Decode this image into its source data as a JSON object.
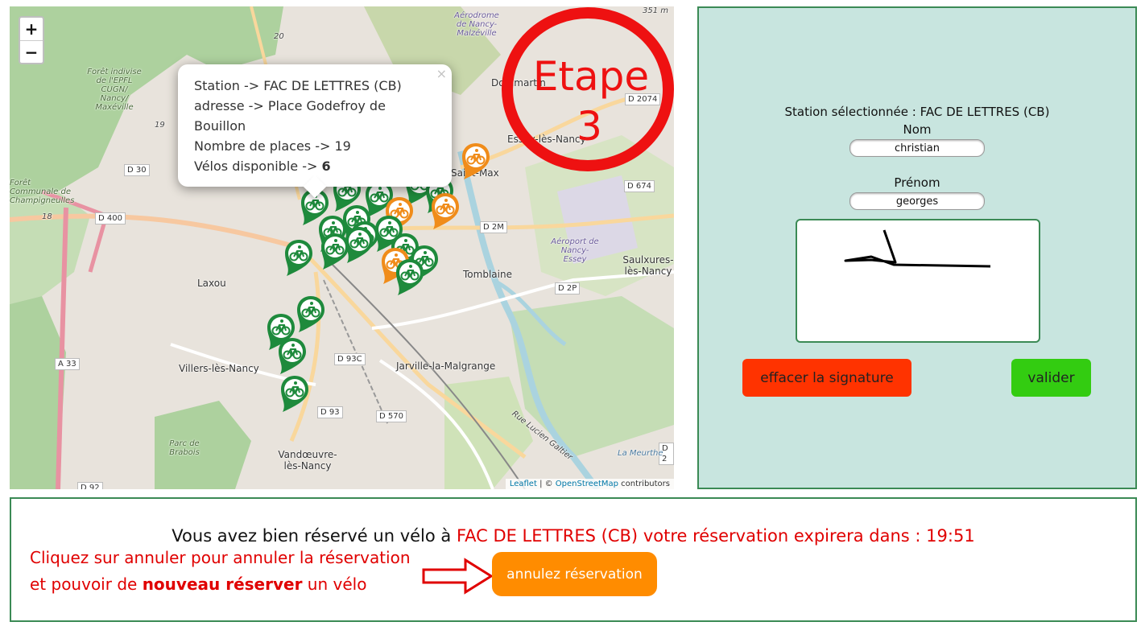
{
  "map": {
    "zoom_in": "+",
    "zoom_out": "−",
    "places": {
      "laxou": "Laxou",
      "villers": "Villers-lès-Nancy",
      "jarville": "Jarville-la-Malgrange",
      "vandoeuvre": "Vandœuvre-lès-Nancy",
      "tomblaine": "Tomblaine",
      "saulxures": "Saulxures-lès-Nancy",
      "essey": "Essey-lès-Nancy",
      "dommartin": "Dommartin",
      "saintmax": "Saint-Max",
      "aerodrome": "Aérodrome de Nancy-Malzéville",
      "aeroport": "Aéroport de Nancy-Essey",
      "foret": "Forêt indivise de l'EPFL CUGN/ Nancy/ Maxéville",
      "champigneulles": "Forêt Communale de Champigneulles",
      "brabois": "Parc de Brabois"
    },
    "roads": {
      "d30": "D 30",
      "d400": "D 400",
      "a33": "A 33",
      "d93c": "D 93C",
      "d93": "D 93",
      "d570": "D 570",
      "d92": "D 92",
      "d2m": "D 2M",
      "d2p": "D 2P",
      "d674": "D 674",
      "d2074": "D 2074",
      "d2": "D 2",
      "n20": "20",
      "n19": "19",
      "n18": "18",
      "alt": "351 m",
      "rue": "Rue Lucien Galtier",
      "meurthe": "La Meurthe"
    },
    "attribution": {
      "leaflet": "Leaflet",
      "sep": " | © ",
      "osm": "OpenStreetMap",
      "rest": " contributors"
    },
    "popup": {
      "station": "Station -> FAC DE LETTRES (CB)",
      "adresse_1": "adresse -> Place Godefroy de",
      "adresse_2": "Bouillon",
      "places": "Nombre de places -> 19",
      "velos_label": "Vélos disponible -> ",
      "velos_value": "6",
      "close": "×"
    },
    "etape": {
      "word": "Etape",
      "number": "3",
      "color": "#ee1111"
    },
    "marker_colors": {
      "available": "#1e8a3c",
      "low": "#f08c1a"
    }
  },
  "form": {
    "station_selected": "Station sélectionnée : FAC DE LETTRES (CB)",
    "nom_label": "Nom",
    "nom_value": "christian",
    "prenom_label": "Prénom",
    "prenom_value": "georges",
    "clear_button": "effacer la signature",
    "validate_button": "valider"
  },
  "reservation": {
    "msg_before": "Vous avez bien réservé un vélo à ",
    "station": "FAC DE LETTRES (CB)",
    "msg_after": " votre réservation expirera dans : 19:51",
    "help_1": "Cliquez sur annuler pour annuler la réservation et pouvoir de ",
    "help_bold": "nouveau réserver",
    "help_2": " un vélo",
    "cancel_button": "annulez réservation"
  }
}
